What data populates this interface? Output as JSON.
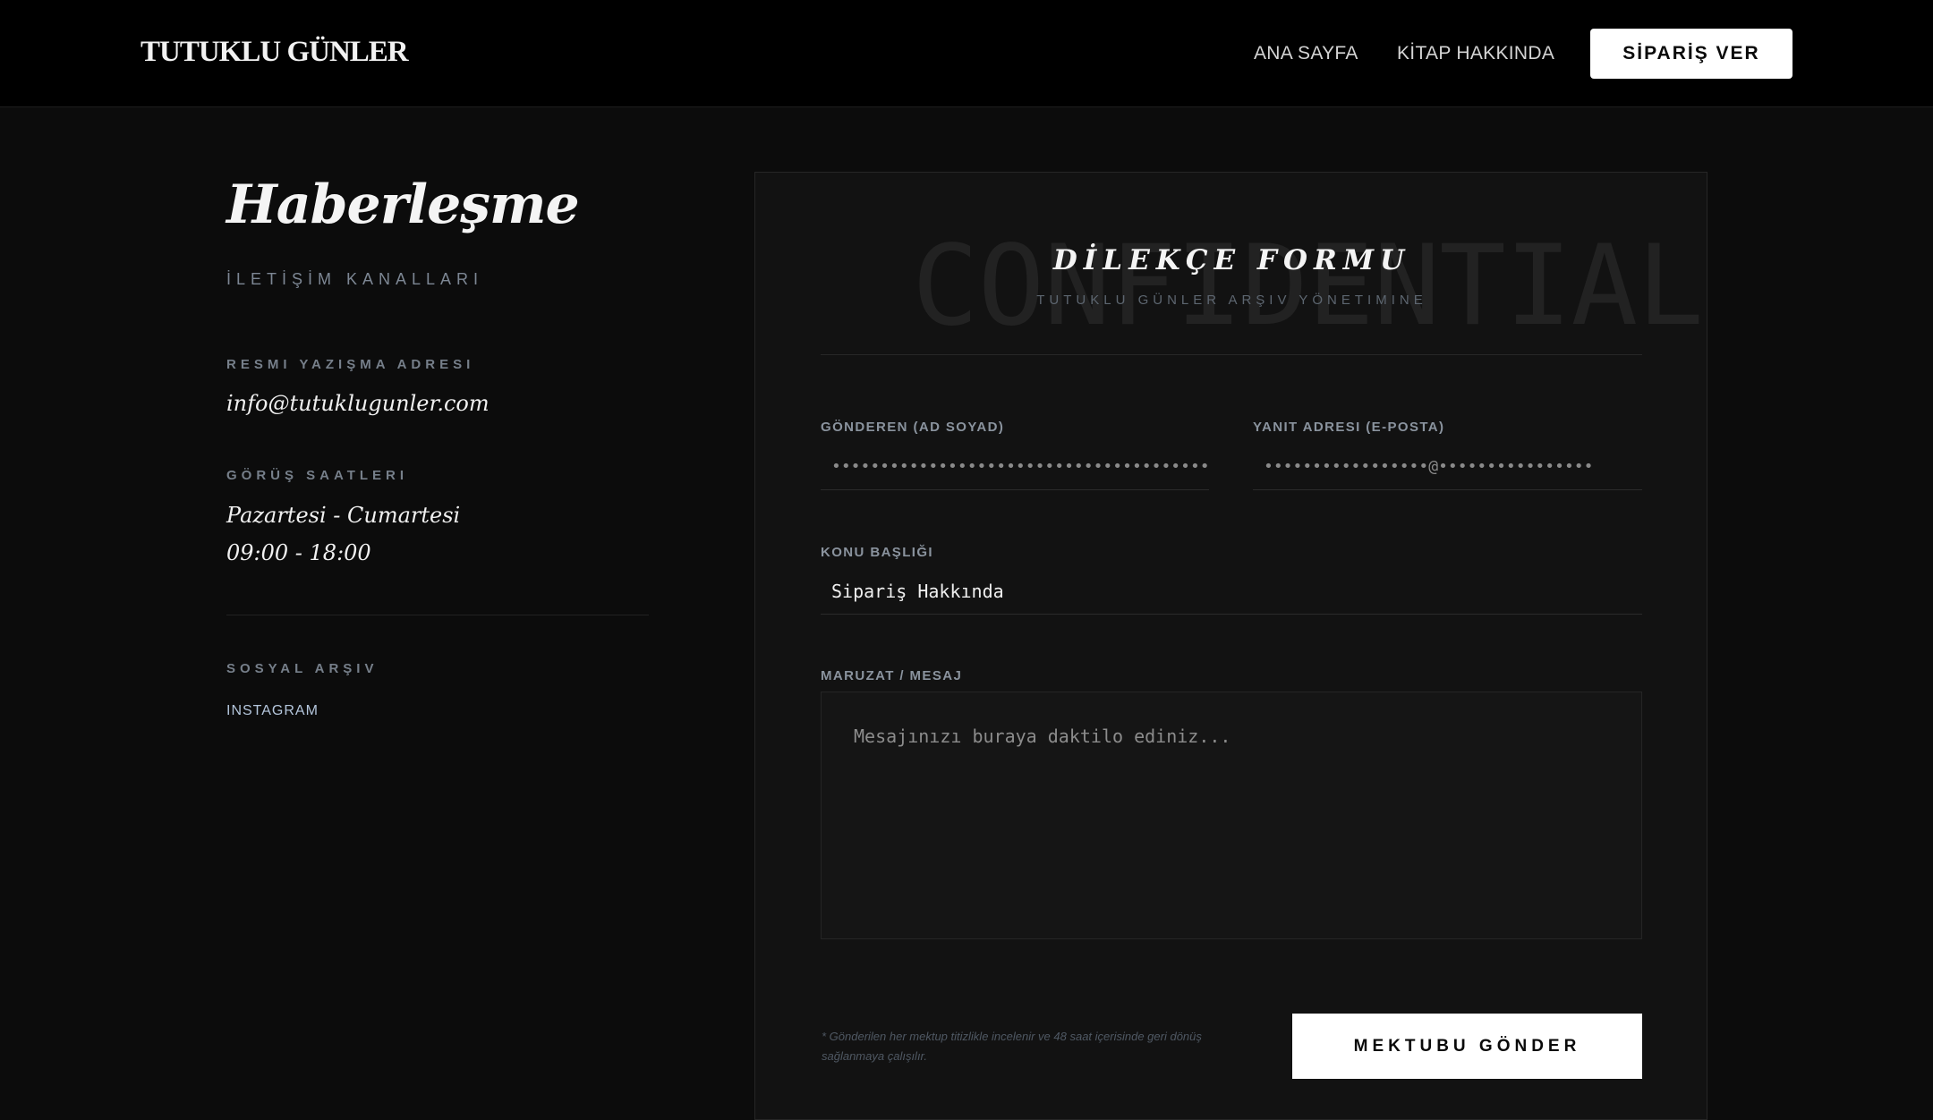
{
  "navbar": {
    "brand": "TUTUKLU GÜNLER",
    "links": [
      "ANA SAYFA",
      "KİTAP HAKKINDA"
    ],
    "order_button": "SİPARİŞ VER"
  },
  "sidebar": {
    "title": "Haberleşme",
    "subtitle": "İLETİŞİM KANALLARI",
    "address_label": "RESMI YAZIŞMA ADRESI",
    "email": "info@tutuklugunler.com",
    "hours_label": "GÖRÜŞ SAATLERI",
    "days": "Pazartesi - Cumartesi",
    "hours": "09:00 - 18:00",
    "social_label": "SOSYAL ARŞIV",
    "instagram": "INSTAGRAM"
  },
  "form": {
    "watermark": "CONFIDENTIAL",
    "title": "DİLEKÇE FORMU",
    "subtitle": "TUTUKLU GÜNLER ARŞIV YÖNETIMINE",
    "name_label": "GÖNDEREN (AD SOYAD)",
    "name_placeholder": "••••••••••••••••••••••••••••••••••••••••••",
    "email_label": "YANIT ADRESI (E-POSTA)",
    "email_placeholder": "•••••••••••••••••@••••••••••••••••",
    "subject_label": "KONU BAŞLIĞI",
    "subject_value": "Sipariş Hakkında",
    "message_label": "MARUZAT / MESAJ",
    "message_placeholder": "Mesajınızı buraya daktilo ediniz...",
    "note": "* Gönderilen her mektup titizlikle incelenir ve 48 saat içerisinde geri dönüş sağlanmaya çalışılır.",
    "submit_button": "MEKTUBU GÖNDER"
  }
}
